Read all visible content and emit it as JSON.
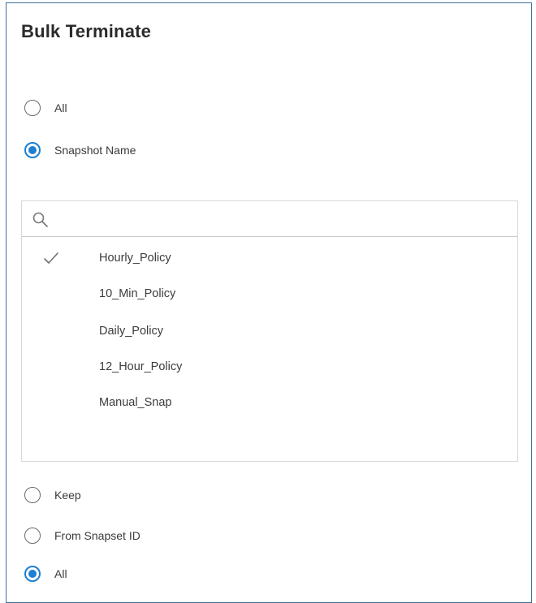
{
  "dialog": {
    "title": "Bulk Terminate"
  },
  "scope_options": [
    {
      "label": "All",
      "selected": false
    },
    {
      "label": "Snapshot Name",
      "selected": true
    }
  ],
  "snapshot_list": {
    "search": {
      "value": "",
      "placeholder": ""
    },
    "items": [
      {
        "label": "Hourly_Policy",
        "checked": true
      },
      {
        "label": "10_Min_Policy",
        "checked": false
      },
      {
        "label": "Daily_Policy",
        "checked": false
      },
      {
        "label": "12_Hour_Policy",
        "checked": false
      },
      {
        "label": "Manual_Snap",
        "checked": false
      }
    ]
  },
  "keep_options": [
    {
      "label": "Keep",
      "selected": false
    },
    {
      "label": "From Snapset ID",
      "selected": false
    },
    {
      "label": "All",
      "selected": true
    }
  ],
  "colors": {
    "accent": "#1e7fd1",
    "panel_border": "#3f6f97"
  }
}
